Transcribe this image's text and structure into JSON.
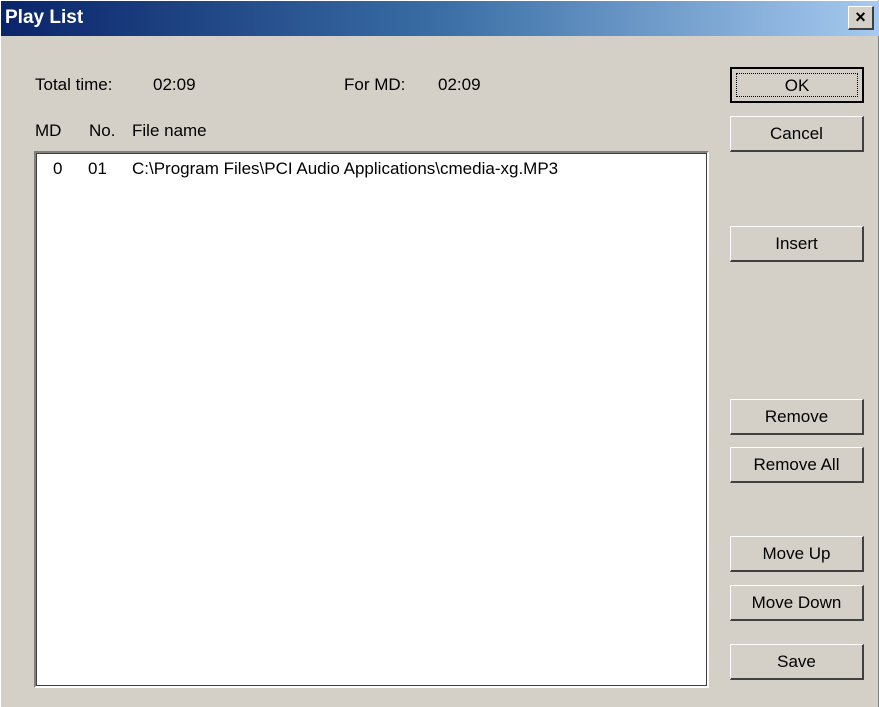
{
  "window": {
    "title": "Play List",
    "close_glyph": "×"
  },
  "summary": {
    "total_time_label": "Total time:",
    "total_time_value": "02:09",
    "for_md_label": "For MD:",
    "for_md_value": "02:09"
  },
  "list": {
    "headers": {
      "md": "MD",
      "no": "No.",
      "file": "File name"
    },
    "rows": [
      {
        "md": "0",
        "no": "01",
        "file": "C:\\Program Files\\PCI Audio Applications\\cmedia-xg.MP3"
      }
    ]
  },
  "buttons": {
    "ok": "OK",
    "cancel": "Cancel",
    "insert": "Insert",
    "remove": "Remove",
    "remove_all": "Remove All",
    "move_up": "Move Up",
    "move_down": "Move Down",
    "save": "Save"
  },
  "colors": {
    "titlebar_start": "#0a246a",
    "titlebar_end": "#a6caf0",
    "face": "#d4d0c8"
  }
}
